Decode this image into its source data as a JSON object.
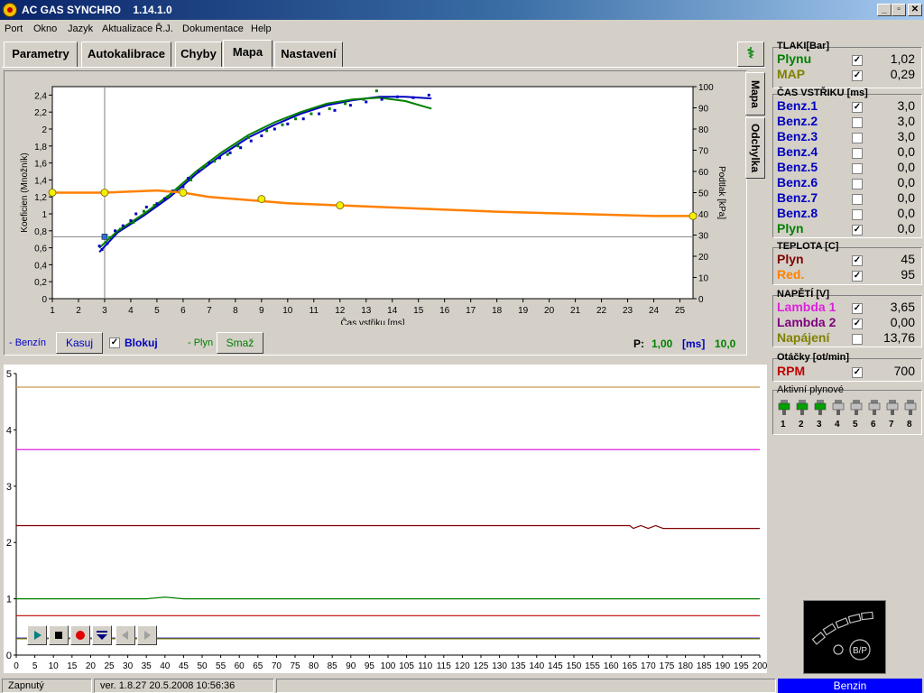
{
  "window": {
    "title": "AC GAS SYNCHRO    1.14.1.0",
    "min_glyph": "_",
    "max_glyph": "▫",
    "close_glyph": "✕"
  },
  "menu": [
    "Port",
    "Okno",
    "Jazyk",
    "Aktualizace Ř.J.",
    "Dokumentace",
    "Help"
  ],
  "tabs": [
    {
      "label": "Parametry"
    },
    {
      "label": "Autokalibrace"
    },
    {
      "label": "Chyby"
    },
    {
      "label": "Mapa",
      "active": true
    },
    {
      "label": "Nastavení"
    }
  ],
  "side_tabs": [
    "Mapa",
    "Odchylka"
  ],
  "map": {
    "benzin_label": "- Benzín",
    "kasuj": "Kasuj",
    "blokuj": "Blokuj",
    "blokuj_checked": true,
    "plyn_label": "- Plyn",
    "smaz": "Smaž",
    "p_label": "P:",
    "p_value": "1,00",
    "p_unit": "[ms]",
    "p_extra": "10,0"
  },
  "status": {
    "state": "Zapnutý",
    "version": "ver. 1.8.27  20.5.2008  10:56:36",
    "mode": "Benzin"
  },
  "sidebar": {
    "pressure": {
      "title": "TLAKI[Bar]",
      "rows": [
        {
          "label": "Plynu",
          "value": "1,02",
          "checked": true,
          "color": "#008000"
        },
        {
          "label": "MAP",
          "value": "0,29",
          "checked": true,
          "color": "#808000"
        }
      ]
    },
    "injection": {
      "title": "ČAS VSTŘIKU  [ms]",
      "rows": [
        {
          "label": "Benz.1",
          "value": "3,0",
          "checked": true,
          "color": "#0000c0"
        },
        {
          "label": "Benz.2",
          "value": "3,0",
          "checked": false,
          "color": "#0000c0"
        },
        {
          "label": "Benz.3",
          "value": "3,0",
          "checked": false,
          "color": "#0000c0"
        },
        {
          "label": "Benz.4",
          "value": "0,0",
          "checked": false,
          "color": "#0000c0"
        },
        {
          "label": "Benz.5",
          "value": "0,0",
          "checked": false,
          "color": "#0000c0"
        },
        {
          "label": "Benz.6",
          "value": "0,0",
          "checked": false,
          "color": "#0000c0"
        },
        {
          "label": "Benz.7",
          "value": "0,0",
          "checked": false,
          "color": "#0000c0"
        },
        {
          "label": "Benz.8",
          "value": "0,0",
          "checked": false,
          "color": "#0000c0"
        },
        {
          "label": "Plyn",
          "value": "0,0",
          "checked": true,
          "color": "#008000"
        }
      ]
    },
    "temperature": {
      "title": "TEPLOTA  [C]",
      "rows": [
        {
          "label": "Plyn",
          "value": "45",
          "checked": true,
          "color": "#800000"
        },
        {
          "label": "Red.",
          "value": "95",
          "checked": true,
          "color": "#ff8000"
        }
      ]
    },
    "voltage": {
      "title": "NAPĚTÍ [V]",
      "rows": [
        {
          "label": "Lambda 1",
          "value": "3,65",
          "checked": true,
          "color": "#e020e0"
        },
        {
          "label": "Lambda 2",
          "value": "0,00",
          "checked": true,
          "color": "#800080"
        },
        {
          "label": "Napájení",
          "value": "13,76",
          "checked": false,
          "color": "#808000"
        }
      ]
    },
    "rpm": {
      "title": "Otáčky [ot/min]",
      "rows": [
        {
          "label": "RPM",
          "value": "700",
          "checked": true,
          "color": "#c00000"
        }
      ]
    },
    "injectors": {
      "title": "Aktivní plynové",
      "items": [
        {
          "label": "1",
          "active": true
        },
        {
          "label": "2",
          "active": true
        },
        {
          "label": "3",
          "active": true
        },
        {
          "label": "4",
          "active": false
        },
        {
          "label": "5",
          "active": false
        },
        {
          "label": "6",
          "active": false
        },
        {
          "label": "7",
          "active": false
        },
        {
          "label": "8",
          "active": false
        }
      ]
    },
    "bp_label": "B/P"
  },
  "chart_data": [
    {
      "type": "scatter",
      "xlabel": "Čas vstřiku [ms]",
      "ylabel": "Koeficien (Množník)",
      "y2label": "Podtlak [kPa]",
      "xlim": [
        1,
        25.5
      ],
      "ylim": [
        0,
        2.5
      ],
      "y2lim": [
        0,
        100
      ],
      "xticks": [
        1,
        2,
        3,
        4,
        5,
        6,
        7,
        8,
        9,
        10,
        11,
        12,
        13,
        14,
        15,
        16,
        17,
        18,
        19,
        20,
        21,
        22,
        23,
        24,
        25
      ],
      "yticks": [
        "0",
        "0,2",
        "0,4",
        "0,6",
        "0,8",
        "1",
        "1,2",
        "1,4",
        "1,6",
        "1,8",
        "2",
        "2,2",
        "2,4"
      ],
      "y2ticks": [
        0,
        10,
        20,
        30,
        40,
        50,
        60,
        70,
        80,
        90,
        100
      ],
      "cursor_x": 3.0,
      "hline_y": 0.73,
      "grid": false,
      "series": [
        {
          "name": "Benzín",
          "color": "#0000c0",
          "kind": "curve",
          "x": [
            2.8,
            3.5,
            4.5,
            5.5,
            6.5,
            7.5,
            8.5,
            9.5,
            10.5,
            11.5,
            12.5,
            13.5,
            14.5,
            15.5
          ],
          "y": [
            0.55,
            0.78,
            0.98,
            1.2,
            1.47,
            1.7,
            1.9,
            2.05,
            2.18,
            2.28,
            2.34,
            2.38,
            2.38,
            2.36
          ]
        },
        {
          "name": "Plyn",
          "color": "#008000",
          "kind": "curve",
          "x": [
            2.8,
            3.5,
            4.5,
            5.5,
            6.5,
            7.5,
            8.5,
            9.5,
            10.5,
            11.5,
            12.5,
            13.5,
            14.5,
            15.5
          ],
          "y": [
            0.6,
            0.8,
            1.0,
            1.23,
            1.5,
            1.73,
            1.93,
            2.08,
            2.2,
            2.3,
            2.35,
            2.37,
            2.33,
            2.24
          ]
        },
        {
          "name": "Benzín body",
          "color": "#0000c0",
          "kind": "points",
          "x": [
            2.8,
            2.9,
            3.1,
            3.4,
            3.7,
            4.0,
            4.2,
            4.6,
            5.0,
            5.3,
            5.6,
            6.0,
            6.2,
            6.6,
            7.0,
            7.4,
            7.8,
            8.2,
            8.6,
            9.0,
            9.5,
            10.0,
            10.6,
            11.2,
            11.8,
            12.4,
            13.0,
            13.6,
            14.2,
            14.8,
            15.4
          ],
          "y": [
            0.62,
            0.58,
            0.65,
            0.8,
            0.86,
            0.92,
            1.0,
            1.08,
            1.12,
            1.18,
            1.27,
            1.32,
            1.42,
            1.5,
            1.6,
            1.66,
            1.72,
            1.78,
            1.86,
            1.92,
            2.0,
            2.06,
            2.12,
            2.18,
            2.22,
            2.28,
            2.32,
            2.35,
            2.38,
            2.37,
            2.4
          ]
        },
        {
          "name": "Plyn body",
          "color": "#008000",
          "kind": "points",
          "x": [
            3.2,
            3.6,
            4.1,
            4.5,
            4.9,
            5.4,
            5.8,
            6.3,
            6.8,
            7.2,
            7.7,
            8.1,
            8.5,
            9.2,
            9.8,
            10.3,
            10.9,
            11.6,
            12.2,
            12.9,
            13.4
          ],
          "y": [
            0.72,
            0.82,
            0.9,
            1.03,
            1.1,
            1.2,
            1.3,
            1.4,
            1.55,
            1.62,
            1.7,
            1.8,
            1.9,
            1.98,
            2.05,
            2.12,
            2.18,
            2.24,
            2.3,
            2.35,
            2.45
          ]
        },
        {
          "name": "Podtlak",
          "color": "#ff8000",
          "kind": "pressure_line",
          "axis": "y2",
          "x": [
            1,
            3,
            5,
            6,
            7,
            9,
            10,
            12,
            15,
            18,
            21,
            24,
            25.5
          ],
          "y": [
            50,
            50,
            51,
            50,
            48,
            46,
            45,
            44,
            42.5,
            41,
            40,
            39,
            39
          ]
        },
        {
          "name": "Podtlak body",
          "color": "#f0f000",
          "kind": "markers",
          "axis": "y2",
          "x": [
            1,
            3,
            6,
            9,
            12,
            25.5
          ],
          "y": [
            50,
            50,
            50,
            47,
            44,
            39
          ]
        }
      ]
    },
    {
      "type": "line",
      "xlim": [
        0,
        200
      ],
      "ylim": [
        0,
        5
      ],
      "xticks": [
        0,
        5,
        10,
        15,
        20,
        25,
        30,
        35,
        40,
        45,
        50,
        55,
        60,
        65,
        70,
        75,
        80,
        85,
        90,
        95,
        100,
        105,
        110,
        115,
        120,
        125,
        130,
        135,
        140,
        145,
        150,
        155,
        160,
        165,
        170,
        175,
        180,
        185,
        190,
        195,
        200
      ],
      "yticks": [
        0,
        1,
        2,
        3,
        4,
        5
      ],
      "series": [
        {
          "name": "Napájení",
          "color": "#c89a50",
          "x": [
            0,
            200
          ],
          "y": [
            4.76,
            4.76
          ]
        },
        {
          "name": "Lambda 1",
          "color": "#e020e0",
          "x": [
            0,
            200
          ],
          "y": [
            3.65,
            3.65
          ]
        },
        {
          "name": "Plyn teplota",
          "color": "#800000",
          "x": [
            0,
            165,
            166,
            168,
            170,
            172,
            174,
            176,
            200
          ],
          "y": [
            2.3,
            2.3,
            2.25,
            2.3,
            2.25,
            2.3,
            2.25,
            2.25,
            2.25
          ]
        },
        {
          "name": "Plyn tlak",
          "color": "#008000",
          "x": [
            0,
            35,
            40,
            45,
            200
          ],
          "y": [
            1.0,
            1.0,
            1.03,
            1.0,
            1.0
          ]
        },
        {
          "name": "RPM",
          "color": "#c00000",
          "x": [
            0,
            200
          ],
          "y": [
            0.7,
            0.7
          ]
        },
        {
          "name": "Benz.1",
          "color": "#0000c0",
          "x": [
            0,
            200
          ],
          "y": [
            0.3,
            0.3
          ]
        },
        {
          "name": "MAP",
          "color": "#808000",
          "x": [
            0,
            200
          ],
          "y": [
            0.29,
            0.29
          ]
        }
      ]
    }
  ]
}
